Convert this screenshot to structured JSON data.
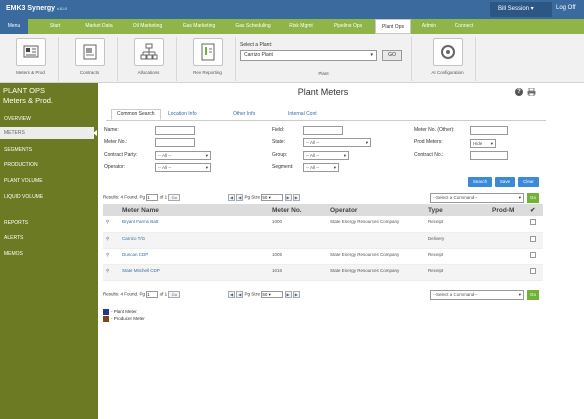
{
  "app": {
    "title": "EMK3 Synergy",
    "version": "v10.0"
  },
  "user": {
    "name": "Bill Session",
    "logoff": "Log Off"
  },
  "nav": {
    "menu": "Menu",
    "tabs": [
      "Start",
      "Market Data",
      "Oil Marketing",
      "Gas Marketing",
      "Gas Scheduling",
      "Risk Mgmt",
      "Pipeline Ops",
      "Plant Ops",
      "Admin",
      "Connect"
    ],
    "active": "Plant Ops"
  },
  "toolbar": {
    "tools": [
      {
        "label": "Meters & Prod",
        "icon": "meter-icon"
      },
      {
        "label": "Contracts",
        "icon": "contract-icon"
      },
      {
        "label": "Allocations",
        "icon": "allocation-icon"
      },
      {
        "label": "Rev Reporting",
        "icon": "report-icon"
      }
    ],
    "plant_label": "Select a Plant:",
    "plant_value": "Carrizo Plant",
    "plant_go": "GO",
    "plant_caption": "Plant",
    "ai_label": "AI Configuration"
  },
  "sidebar": {
    "title_line1": "PLANT OPS",
    "title_line2": "Meters & Prod.",
    "items": [
      "OVERVIEW",
      "METERS",
      "SEGMENTS",
      "PRODUCTION",
      "PLANT VOLUME",
      "LIQUID VOLUME",
      "REPORTS",
      "ALERTS",
      "MEMOS"
    ],
    "active": "METERS"
  },
  "page": {
    "title": "Plant Meters",
    "subtabs": [
      "Common Search",
      "Location Info",
      "Other Info",
      "Internal Cont"
    ]
  },
  "search": {
    "name_label": "Name:",
    "meter_no_label": "Meter No.:",
    "contract_party_label": "Contract Party:",
    "contract_party_value": "-- All --",
    "operator_label": "Operator:",
    "operator_value": "-- All --",
    "field_label": "Field:",
    "state_label": "State:",
    "state_value": "-- All --",
    "group_label": "Group:",
    "group_value": "-- All --",
    "segment_label": "Segment:",
    "segment_value": "-- All --",
    "meter_other_label": "Meter No. (Other):",
    "prod_meters_label": "Prod Meters:",
    "prod_meters_value": "Hide",
    "contract_no_label": "Contract No.:",
    "search_btn": "Search",
    "save_btn": "Save",
    "clear_btn": "Clear"
  },
  "pager": {
    "results_text": "Results: 4 Found. Pg",
    "page": "1",
    "of_text": "of 1",
    "go": "Go",
    "pg_size_label": "Pg Size",
    "pg_size": "50",
    "command_placeholder": "--Select a Command--",
    "command_go": "Go"
  },
  "table": {
    "headers": [
      "Meter Name",
      "Meter No.",
      "Operator",
      "Type",
      "Prod-M"
    ],
    "rows": [
      {
        "name": "Bryant Farms Batt",
        "no": "1000",
        "operator": "State Energy Resources Company",
        "type": "Receipt"
      },
      {
        "name": "Carrizo T/G",
        "no": "",
        "operator": "",
        "type": "Delivery"
      },
      {
        "name": "Duncan CDP",
        "no": "1005",
        "operator": "State Energy Resources Company",
        "type": "Receipt"
      },
      {
        "name": "State Mitchell CDP",
        "no": "1016",
        "operator": "State Energy Resources Company",
        "type": "Receipt"
      }
    ]
  },
  "legend": [
    {
      "label": "- Plant Meter",
      "color": "#1f3a93"
    },
    {
      "label": "- Producer Meter",
      "color": "#7a4a1a"
    }
  ]
}
